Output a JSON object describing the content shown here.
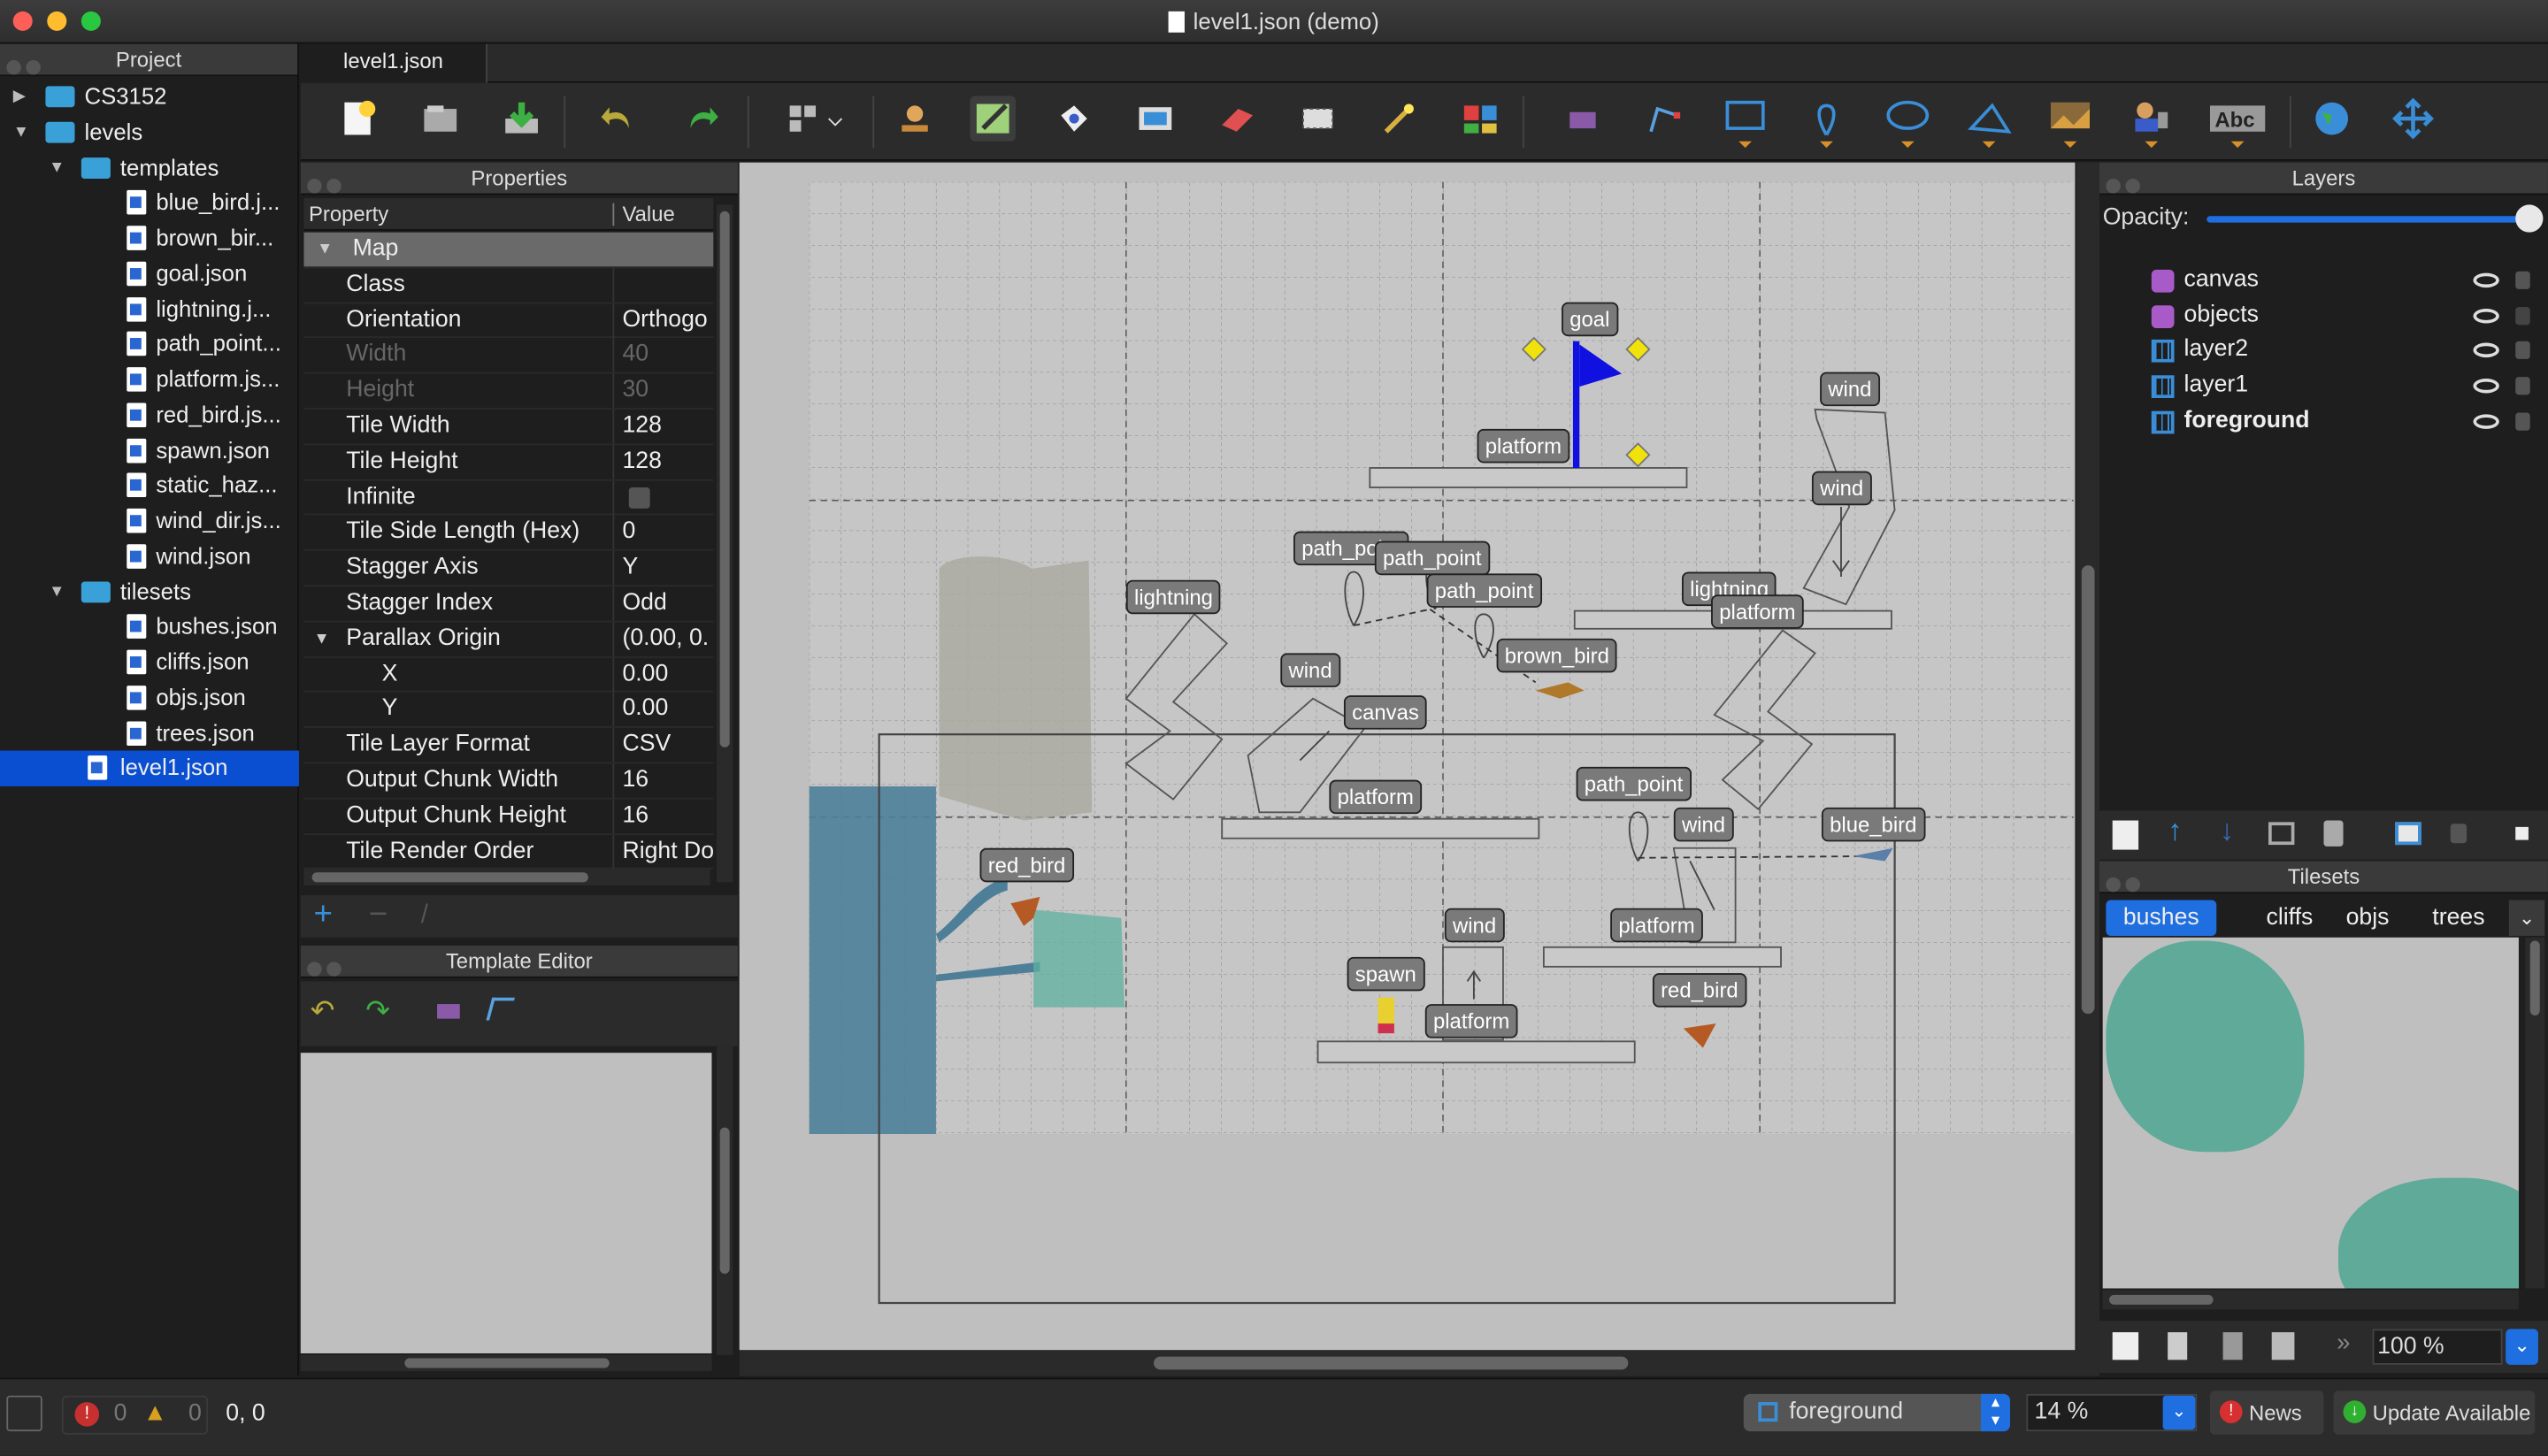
{
  "window": {
    "title": "level1.json (demo)"
  },
  "project": {
    "title": "Project",
    "items": [
      {
        "label": "CS3152",
        "type": "folder",
        "depth": 0,
        "arrow": "▶"
      },
      {
        "label": "levels",
        "type": "folder",
        "depth": 0,
        "arrow": "▼"
      },
      {
        "label": "templates",
        "type": "folder",
        "depth": 1,
        "arrow": "▼"
      },
      {
        "label": "blue_bird.j...",
        "type": "file",
        "depth": 2
      },
      {
        "label": "brown_bir...",
        "type": "file",
        "depth": 2
      },
      {
        "label": "goal.json",
        "type": "file",
        "depth": 2
      },
      {
        "label": "lightning.j...",
        "type": "file",
        "depth": 2
      },
      {
        "label": "path_point...",
        "type": "file",
        "depth": 2
      },
      {
        "label": "platform.js...",
        "type": "file",
        "depth": 2
      },
      {
        "label": "red_bird.js...",
        "type": "file",
        "depth": 2
      },
      {
        "label": "spawn.json",
        "type": "file",
        "depth": 2
      },
      {
        "label": "static_haz...",
        "type": "file",
        "depth": 2
      },
      {
        "label": "wind_dir.js...",
        "type": "file",
        "depth": 2
      },
      {
        "label": "wind.json",
        "type": "file",
        "depth": 2
      },
      {
        "label": "tilesets",
        "type": "folder",
        "depth": 1,
        "arrow": "▼"
      },
      {
        "label": "bushes.json",
        "type": "file",
        "depth": 2
      },
      {
        "label": "cliffs.json",
        "type": "file",
        "depth": 2
      },
      {
        "label": "objs.json",
        "type": "file",
        "depth": 2
      },
      {
        "label": "trees.json",
        "type": "file",
        "depth": 2
      },
      {
        "label": "level1.json",
        "type": "file",
        "depth": 1,
        "selected": true
      }
    ]
  },
  "tabs": [
    {
      "label": "level1.json"
    }
  ],
  "properties": {
    "title": "Properties",
    "col_property": "Property",
    "col_value": "Value",
    "rows": [
      {
        "k": "Map",
        "v": "",
        "group": true
      },
      {
        "k": "Class",
        "v": ""
      },
      {
        "k": "Orientation",
        "v": "Orthogo"
      },
      {
        "k": "Width",
        "v": "40",
        "disabled": true
      },
      {
        "k": "Height",
        "v": "30",
        "disabled": true
      },
      {
        "k": "Tile Width",
        "v": "128"
      },
      {
        "k": "Tile Height",
        "v": "128"
      },
      {
        "k": "Infinite",
        "v": "",
        "checkbox": true
      },
      {
        "k": "Tile Side Length (Hex)",
        "v": "0"
      },
      {
        "k": "Stagger Axis",
        "v": "Y"
      },
      {
        "k": "Stagger Index",
        "v": "Odd"
      },
      {
        "k": "Parallax Origin",
        "v": "(0.00, 0.",
        "expand": true
      },
      {
        "k": "X",
        "v": "0.00",
        "sub": true
      },
      {
        "k": "Y",
        "v": "0.00",
        "sub": true
      },
      {
        "k": "Tile Layer Format",
        "v": "CSV"
      },
      {
        "k": "Output Chunk Width",
        "v": "16"
      },
      {
        "k": "Output Chunk Height",
        "v": "16"
      },
      {
        "k": "Tile Render Order",
        "v": "Right Do"
      }
    ]
  },
  "template_editor": {
    "title": "Template Editor"
  },
  "map_labels": [
    {
      "text": "goal"
    },
    {
      "text": "platform"
    },
    {
      "text": "wind"
    },
    {
      "text": "wind"
    },
    {
      "text": "path_point"
    },
    {
      "text": "path_point"
    },
    {
      "text": "path_point"
    },
    {
      "text": "lightning"
    },
    {
      "text": "lightning"
    },
    {
      "text": "platform"
    },
    {
      "text": "brown_bird"
    },
    {
      "text": "wind"
    },
    {
      "text": "canvas"
    },
    {
      "text": "platform"
    },
    {
      "text": "path_point"
    },
    {
      "text": "wind"
    },
    {
      "text": "blue_bird"
    },
    {
      "text": "red_bird"
    },
    {
      "text": "platform"
    },
    {
      "text": "wind"
    },
    {
      "text": "spawn"
    },
    {
      "text": "platform"
    },
    {
      "text": "red_bird"
    }
  ],
  "layers": {
    "title": "Layers",
    "opacity_label": "Opacity:",
    "opacity": 1.0,
    "items": [
      {
        "name": "canvas",
        "kind": "object"
      },
      {
        "name": "objects",
        "kind": "object",
        "unlocked": true
      },
      {
        "name": "layer2",
        "kind": "tile"
      },
      {
        "name": "layer1",
        "kind": "tile"
      },
      {
        "name": "foreground",
        "kind": "tile",
        "bold": true
      }
    ]
  },
  "tilesets": {
    "title": "Tilesets",
    "tabs": [
      "bushes",
      "cliffs",
      "objs",
      "trees"
    ],
    "active_tab": "bushes",
    "zoom": "100 %"
  },
  "status": {
    "errors": "0",
    "warnings": "0",
    "coords": "0, 0",
    "layer_select": "foreground",
    "zoom": "14 %",
    "news": "News",
    "update": "Update Available"
  },
  "colors": {
    "accent": "#0a4fd1",
    "selection": "#1f5fd6",
    "goal_flag": "#1010e0",
    "teal": "#4a9a8f"
  }
}
